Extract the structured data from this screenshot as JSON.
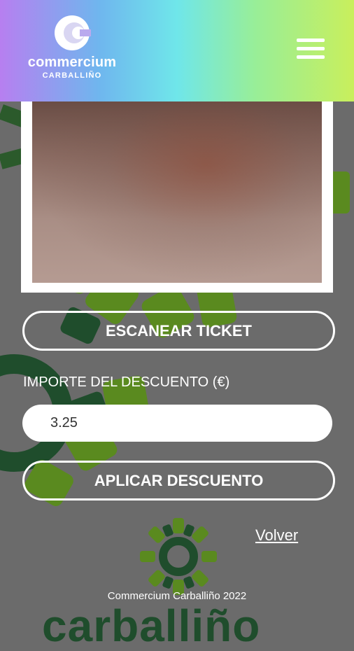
{
  "header": {
    "brand": "commercium",
    "brand_sub": "CARBALLIÑO",
    "menu_icon": "hamburger-menu-icon"
  },
  "scanner": {
    "scan_button": "ESCANEAR TICKET"
  },
  "discount": {
    "label": "IMPORTE DEL DESCUENTO (€)",
    "value": "3.25",
    "apply_button": "APLICAR DESCUENTO"
  },
  "links": {
    "back": "Volver"
  },
  "footer": {
    "copyright": "Commercium Carballiño 2022",
    "bottom_word": "carballiño"
  },
  "colors": {
    "background": "#6b6b6b",
    "accent_green": "#1f4d2c",
    "light_green": "#5a8a1f"
  }
}
